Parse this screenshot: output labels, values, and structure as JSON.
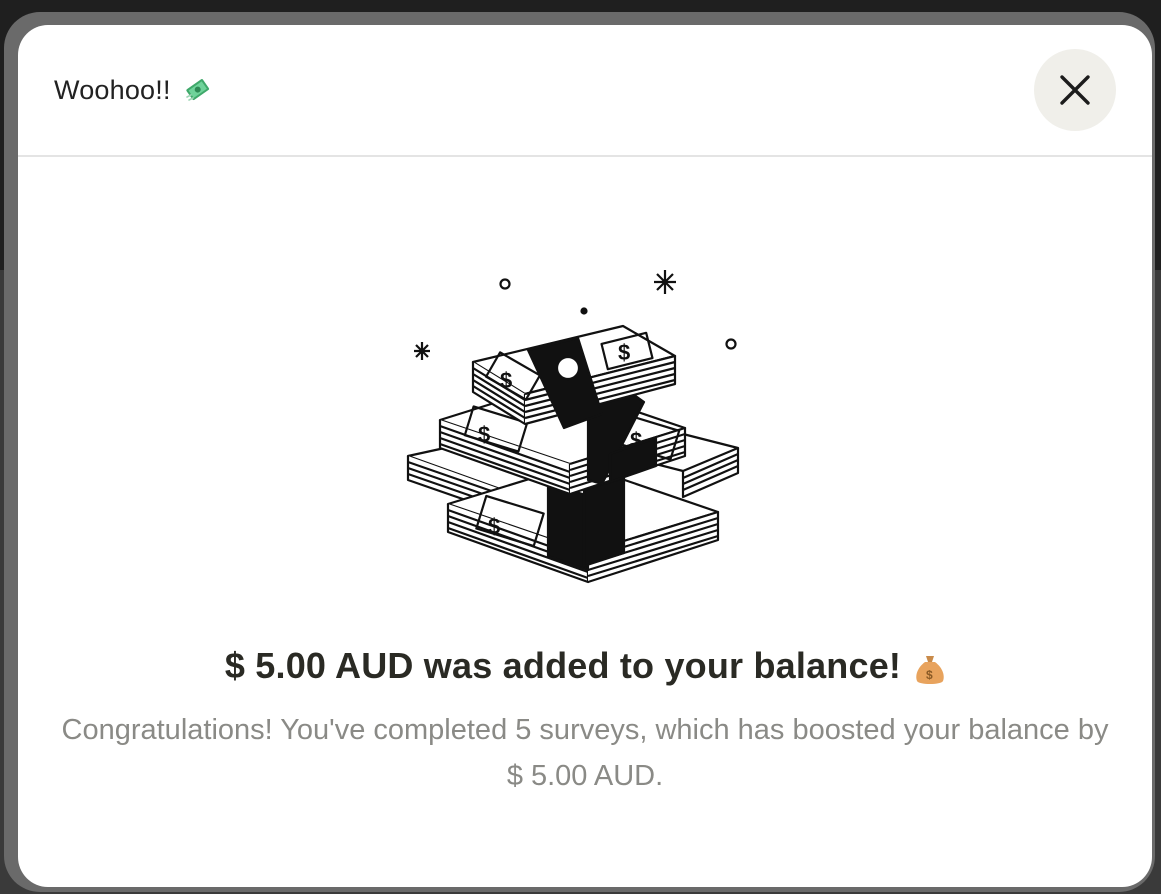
{
  "modal": {
    "title": "Woohoo!!",
    "title_icon": "money-with-wings-icon",
    "close_icon": "close-icon",
    "illustration": "cash-stacks-illustration",
    "headline": "$ 5.00 AUD was added to your balance!",
    "headline_icon": "money-bag-icon",
    "description": "Congratulations! You've completed 5 surveys, which has boosted your balance by $ 5.00 AUD."
  },
  "colors": {
    "overlay": "#2b2b2b",
    "modal_background": "#ffffff",
    "close_button_background": "#f0efea",
    "headline_text": "#2a2a24",
    "body_text": "#8a8a86"
  }
}
